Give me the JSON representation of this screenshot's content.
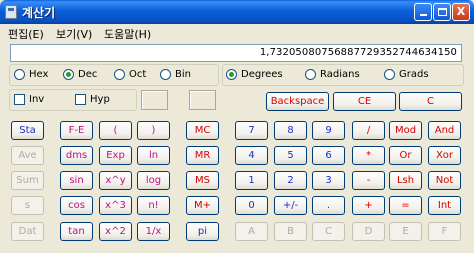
{
  "window": {
    "title": "계산기"
  },
  "title_buttons": {
    "minimize_icon": "minimize-icon",
    "maximize_icon": "maximize-icon",
    "close_label": "X"
  },
  "menu": [
    "편집(E)",
    "보기(V)",
    "도움말(H)"
  ],
  "display": {
    "value": "1,73205080756887729352744634150"
  },
  "number_base": {
    "options": [
      "Hex",
      "Dec",
      "Oct",
      "Bin"
    ],
    "selected": "Dec"
  },
  "angle_mode": {
    "options": [
      "Degrees",
      "Radians",
      "Grads"
    ],
    "selected": "Degrees"
  },
  "modifiers": {
    "inv": "Inv",
    "hyp": "Hyp"
  },
  "top_buttons": {
    "backspace": "Backspace",
    "ce": "CE",
    "c": "C"
  },
  "stat_column": [
    "Sta",
    "Ave",
    "Sum",
    "s",
    "Dat"
  ],
  "sci_col1": [
    "F-E",
    "dms",
    "sin",
    "cos",
    "tan"
  ],
  "sci_col2": [
    "(",
    "Exp",
    "x^y",
    "x^3",
    "x^2"
  ],
  "sci_col3": [
    ")",
    "ln",
    "log",
    "n!",
    "1/x"
  ],
  "memory_column": [
    "MC",
    "MR",
    "MS",
    "M+",
    "pi"
  ],
  "num_col1": [
    "7",
    "4",
    "1",
    "0",
    "A"
  ],
  "num_col2": [
    "8",
    "5",
    "2",
    "+/-",
    "B"
  ],
  "num_col3": [
    "9",
    "6",
    "3",
    ".",
    "C"
  ],
  "op_col1": [
    "/",
    "*",
    "-",
    "+",
    "D"
  ],
  "op_col2": [
    "Mod",
    "Or",
    "Lsh",
    "=",
    "E"
  ],
  "op_col3": [
    "And",
    "Xor",
    "Not",
    "Int",
    "F"
  ],
  "colors": {
    "blue_text": "#1a2fc8",
    "red_text": "#d80000",
    "disabled_text": "#b0ad9c"
  }
}
